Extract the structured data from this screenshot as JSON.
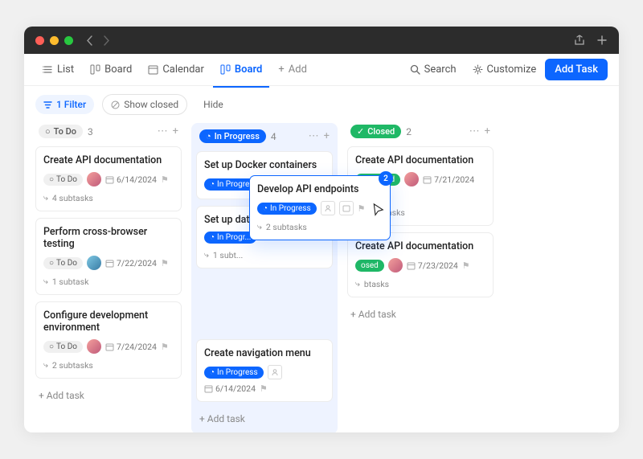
{
  "titlebar": {
    "share_icon": "share",
    "plus_icon": "+"
  },
  "tabs": {
    "list": "List",
    "board1": "Board",
    "calendar": "Calendar",
    "board2": "Board",
    "add": "Add"
  },
  "toolbar_right": {
    "search": "Search",
    "customize": "Customize",
    "addtask": "Add Task"
  },
  "filters": {
    "filter": "1 Filter",
    "show_closed": "Show closed",
    "hide": "Hide"
  },
  "columns": {
    "todo": {
      "label": "To Do",
      "count": "3",
      "addtask": "Add task",
      "cards": [
        {
          "title": "Create API documentation",
          "status": "To Do",
          "date": "6/14/2024",
          "subs": "4 subtasks"
        },
        {
          "title": "Perform cross-browser testing",
          "status": "To Do",
          "date": "7/22/2024",
          "subs": "1 subtask"
        },
        {
          "title": "Configure development environment",
          "status": "To Do",
          "date": "7/24/2024",
          "subs": "2 subtasks"
        }
      ]
    },
    "prog": {
      "label": "In Progress",
      "count": "4",
      "addtask": "Add task",
      "cards": [
        {
          "title": "Set up Docker containers",
          "status": "In Progress"
        },
        {
          "title": "Set up database schema",
          "status": "In Progr...",
          "subs": "1 subt..."
        },
        {
          "title": "Create navigation menu",
          "status": "In Progress",
          "date": "6/14/2024"
        }
      ]
    },
    "done": {
      "label": "Closed",
      "count": "2",
      "addtask": "Add task",
      "cards": [
        {
          "title": "Create API documentation",
          "status": "Closed",
          "date": "7/21/2024",
          "subs": "4 subtasks"
        },
        {
          "title": "Create API documentation",
          "status": "osed",
          "date": "7/23/2024",
          "subs": "btasks"
        }
      ]
    }
  },
  "drag": {
    "title": "Develop API endpoints",
    "status": "In Progress",
    "subs": "2 subtasks",
    "badge": "2"
  },
  "icons": {
    "circle": "○",
    "clock": "◔",
    "check": "✓",
    "cal": "🗓",
    "flag": "⚑",
    "sub": "⤷",
    "plus": "+",
    "dots": "⋯",
    "filter": "≡",
    "hide": "⊘"
  }
}
